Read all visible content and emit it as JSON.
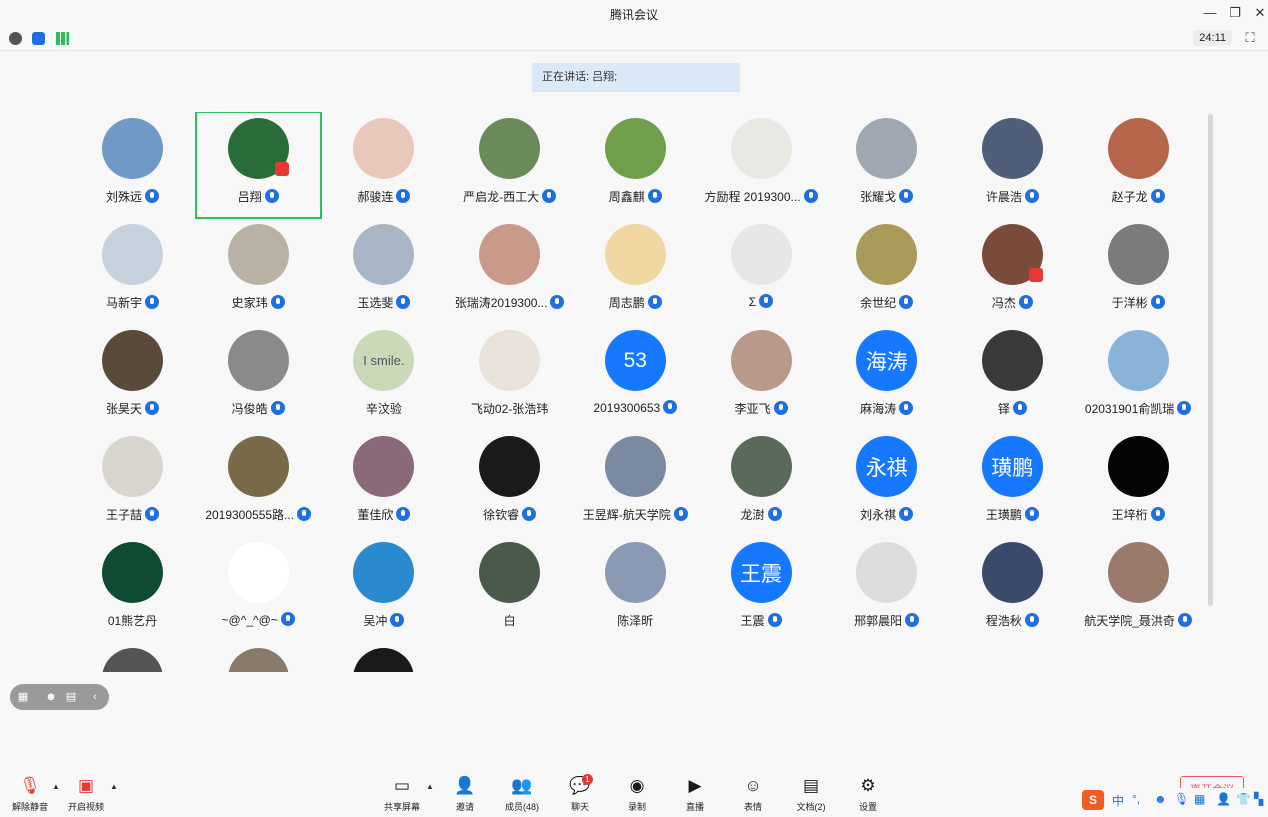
{
  "window": {
    "title": "腾讯会议"
  },
  "status": {
    "timer": "24:11"
  },
  "speaking": {
    "text": "正在讲话: 吕翔;"
  },
  "participants": [
    {
      "name": "刘殊远",
      "mic": true,
      "color": "#6f9ac5"
    },
    {
      "name": "吕翔",
      "mic": true,
      "color": "#2a6d3a",
      "active": true,
      "badge": true
    },
    {
      "name": "郝骏连",
      "mic": true,
      "color": "#e8c8b9"
    },
    {
      "name": "严启龙-西工大",
      "mic": true,
      "color": "#6a8a5a"
    },
    {
      "name": "周鑫麒",
      "mic": true,
      "color": "#6f9f4a"
    },
    {
      "name": "方励程 2019300...",
      "mic": true,
      "color": "#e8e8e2"
    },
    {
      "name": "张耀戈",
      "mic": true,
      "color": "#9fa7b3"
    },
    {
      "name": "许晨浩",
      "mic": true,
      "color": "#4f5f7a"
    },
    {
      "name": "赵子龙",
      "mic": true,
      "color": "#b4654a"
    },
    {
      "name": "马新宇",
      "mic": true,
      "color": "#c5d2de"
    },
    {
      "name": "史家玮",
      "mic": true,
      "color": "#b9b2a4"
    },
    {
      "name": "玉选斐",
      "mic": true,
      "color": "#a8b5c5"
    },
    {
      "name": "张瑞涛2019300...",
      "mic": true,
      "color": "#c99a8a"
    },
    {
      "name": "周志鹏",
      "mic": true,
      "color": "#f0d7a2"
    },
    {
      "name": "Σ",
      "mic": true,
      "color": "#e6e6e6"
    },
    {
      "name": "余世纪",
      "mic": true,
      "color": "#a99a5a"
    },
    {
      "name": "冯杰",
      "mic": true,
      "color": "#7a4a3a",
      "badge": true
    },
    {
      "name": "于洋彬",
      "mic": true,
      "color": "#7b7b7b"
    },
    {
      "name": "张昊天",
      "mic": true,
      "color": "#5a4a3a"
    },
    {
      "name": "冯俊皓",
      "mic": true,
      "color": "#8a8a8a"
    },
    {
      "name": "辛汶验",
      "mic": false,
      "color": "#c9d9b8",
      "text": "I smile."
    },
    {
      "name": "飞动02-张浩玮",
      "mic": false,
      "color": "#e9e2da"
    },
    {
      "name": "2019300653",
      "mic": true,
      "color": "#1677ff",
      "text": "53"
    },
    {
      "name": "李亚飞",
      "mic": true,
      "color": "#b99a8a"
    },
    {
      "name": "麻海涛",
      "mic": true,
      "color": "#1677ff",
      "text": "海涛"
    },
    {
      "name": "铎",
      "mic": true,
      "color": "#3a3a3a"
    },
    {
      "name": "02031901俞凯瑞",
      "mic": true,
      "color": "#8ab3d9"
    },
    {
      "name": "王子喆",
      "mic": true,
      "color": "#d8d4ce"
    },
    {
      "name": "2019300555路...",
      "mic": true,
      "color": "#7a6a4a"
    },
    {
      "name": "董佳欣",
      "mic": true,
      "color": "#8a6a7a"
    },
    {
      "name": "徐钦睿",
      "mic": true,
      "color": "#1a1a1a"
    },
    {
      "name": "王昱辉-航天学院",
      "mic": true,
      "color": "#7a8aa0"
    },
    {
      "name": "龙澍",
      "mic": true,
      "color": "#5a6a5a"
    },
    {
      "name": "刘永祺",
      "mic": true,
      "color": "#1677ff",
      "text": "永祺"
    },
    {
      "name": "王璜鹏",
      "mic": true,
      "color": "#1677ff",
      "text": "璜鹏"
    },
    {
      "name": "王垶桁",
      "mic": true,
      "color": "#050505"
    },
    {
      "name": "01熊艺丹",
      "mic": false,
      "color": "#0f4a32"
    },
    {
      "name": "~@^_^@~",
      "mic": true,
      "color": "#ffffff"
    },
    {
      "name": "吴冲",
      "mic": true,
      "color": "#2a8ad0"
    },
    {
      "name": "白",
      "mic": false,
      "color": "#4a5a4a"
    },
    {
      "name": "陈泽昕",
      "mic": false,
      "color": "#8a9ab5"
    },
    {
      "name": "王震",
      "mic": true,
      "color": "#1677ff",
      "text": "王震"
    },
    {
      "name": "邢郭晨阳",
      "mic": true,
      "color": "#dcdcdc"
    },
    {
      "name": "程浩秋",
      "mic": true,
      "color": "#3a4a6a"
    },
    {
      "name": "航天学院_聂洪奇",
      "mic": true,
      "color": "#9a7a6a"
    },
    {
      "name": "",
      "mic": false,
      "color": "#555555"
    },
    {
      "name": "",
      "mic": false,
      "color": "#8a7a6a"
    },
    {
      "name": "",
      "mic": false,
      "color": "#1a1a1a"
    }
  ],
  "toolbar": {
    "unmute": "解除静音",
    "start_video": "开启视频",
    "share": "共享屏幕",
    "invite": "邀请",
    "members": "成员(48)",
    "chat": "聊天",
    "chat_badge": "1",
    "record": "录制",
    "live": "直播",
    "reaction": "表情",
    "docs": "文档(2)",
    "settings": "设置",
    "leave": "离开会议"
  },
  "ime": {
    "lang": "中"
  }
}
